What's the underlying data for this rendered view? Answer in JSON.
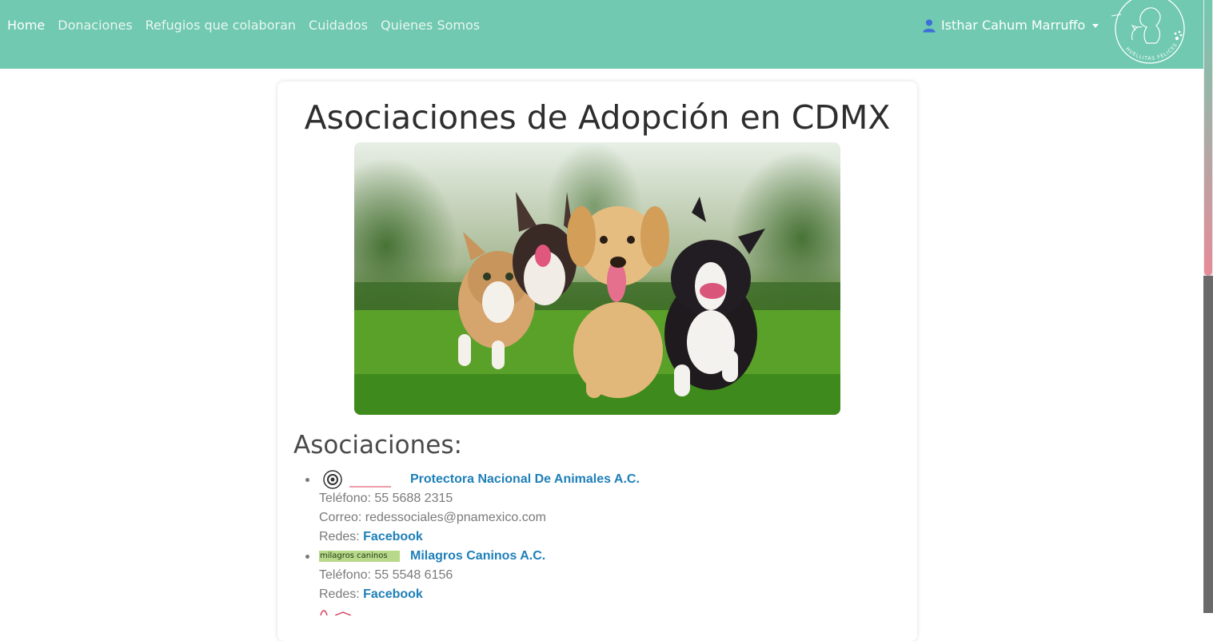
{
  "nav": {
    "links": [
      "Home",
      "Donaciones",
      "Refugios que colaboran",
      "Cuidados",
      "Quienes Somos"
    ],
    "user_name": "Isthar Cahum Marruffo",
    "logo_text": "HUELLITAS FELICES"
  },
  "main": {
    "title": "Asociaciones de Adopción en CDMX",
    "section_title": "Asociaciones:",
    "associations": [
      {
        "name": "Protectora Nacional De Animales A.C.",
        "phone": "Teléfono: 55 5688 2315",
        "email": "Correo: redessociales@pnamexico.com",
        "social_prefix": "Redes: ",
        "social_link": "Facebook"
      },
      {
        "name": "Milagros Caninos A.C.",
        "logo_text": "milagros caninos",
        "phone": "Teléfono: 55 5548 6156",
        "social_prefix": "Redes: ",
        "social_link": "Facebook"
      }
    ]
  },
  "colors": {
    "navbar": "#70c9b0",
    "link": "#1e7fb8",
    "accent_pink": "#e78b98"
  }
}
